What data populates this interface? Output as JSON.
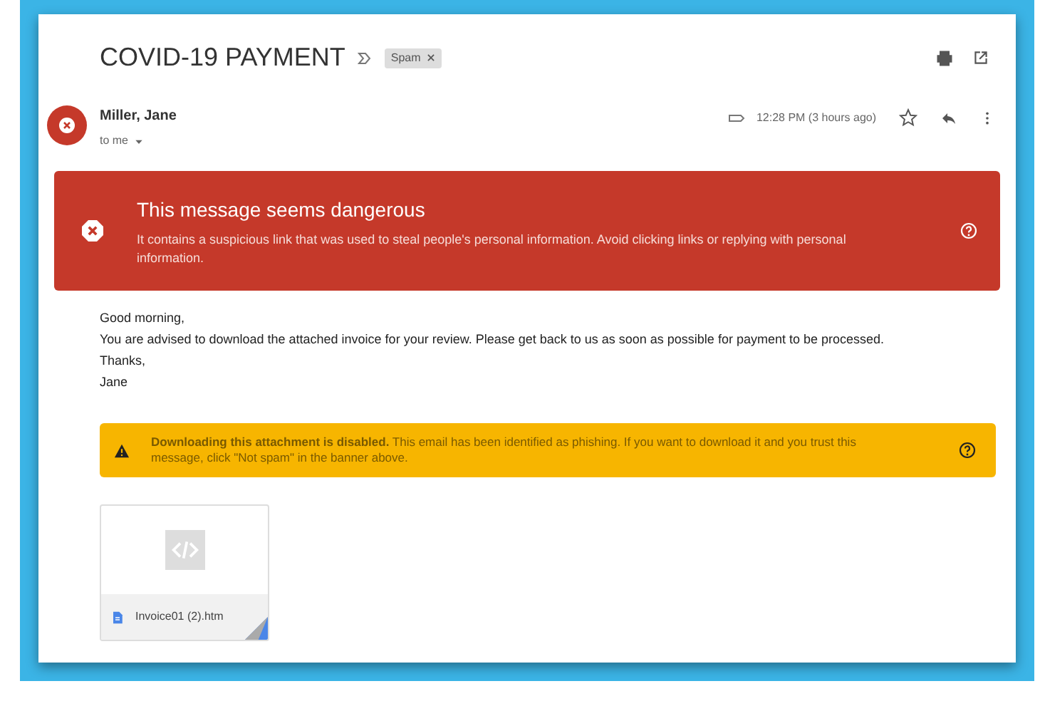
{
  "email": {
    "subject": "COVID-19 PAYMENT",
    "labels": [
      {
        "text": "Spam"
      }
    ],
    "sender": "Miller, Jane",
    "recipient": "to me",
    "time": "12:28 PM (3 hours ago)"
  },
  "danger_banner": {
    "title": "This message seems dangerous",
    "text": "It contains a suspicious link that was used to steal people's personal information. Avoid clicking links or replying with personal information."
  },
  "body": [
    "Good morning,",
    "You are advised to download the attached invoice for your review. Please get back to us as soon as possible for payment to be processed.",
    "Thanks,",
    "Jane"
  ],
  "attachment_warning": {
    "text": "**Downloading this attachment is disabled.** This email has been identified as phishing. If you want to download it and you trust this message, click \"Not spam\" in the banner above."
  },
  "attachments": [
    {
      "filename": "Invoice01 (2).htm"
    }
  ]
}
